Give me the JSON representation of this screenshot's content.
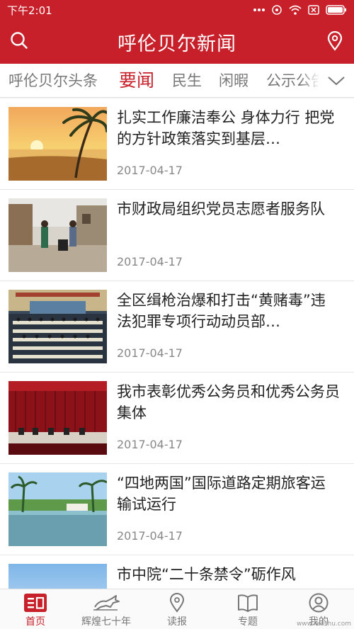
{
  "statusbar": {
    "time": "下午2:01"
  },
  "header": {
    "title": "呼伦贝尔新闻"
  },
  "tabs": [
    {
      "label": "呼伦贝尔头条"
    },
    {
      "label": "要闻"
    },
    {
      "label": "民生"
    },
    {
      "label": "闲暇"
    },
    {
      "label": "公示公告"
    }
  ],
  "active_tab": "要闻",
  "news": [
    {
      "title": "扎实工作廉洁奉公 身体力行 把党的方针政策落实到基层…",
      "date": "2017-04-17",
      "image": "beach-sunset"
    },
    {
      "title": "市财政局组织党员志愿者服务队",
      "date": "2017-04-17",
      "image": "volunteers-cleanup"
    },
    {
      "title": "全区缉枪治爆和打击“黄赌毒”违法犯罪专项行动动员部…",
      "date": "2017-04-17",
      "image": "conference-hall"
    },
    {
      "title": "我市表彰优秀公务员和优秀公务员集体",
      "date": "2017-04-17",
      "image": "award-stage"
    },
    {
      "title": "“四地两国”国际道路定期旅客运输试运行",
      "date": "2017-04-17",
      "image": "tropical-river"
    },
    {
      "title": "市中院“二十条禁令”砺作风",
      "date": "",
      "image": "sky"
    }
  ],
  "tabbar": [
    {
      "label": "首页",
      "icon": "home-icon"
    },
    {
      "label": "辉煌七十年",
      "icon": "horse-icon"
    },
    {
      "label": "读报",
      "icon": "location-pin-icon"
    },
    {
      "label": "专题",
      "icon": "book-icon"
    },
    {
      "label": "我的",
      "icon": "user-icon"
    }
  ],
  "watermark": "www.redshu.com",
  "colors": {
    "brand_red": "#c8202a",
    "inactive_gray": "#777777"
  }
}
